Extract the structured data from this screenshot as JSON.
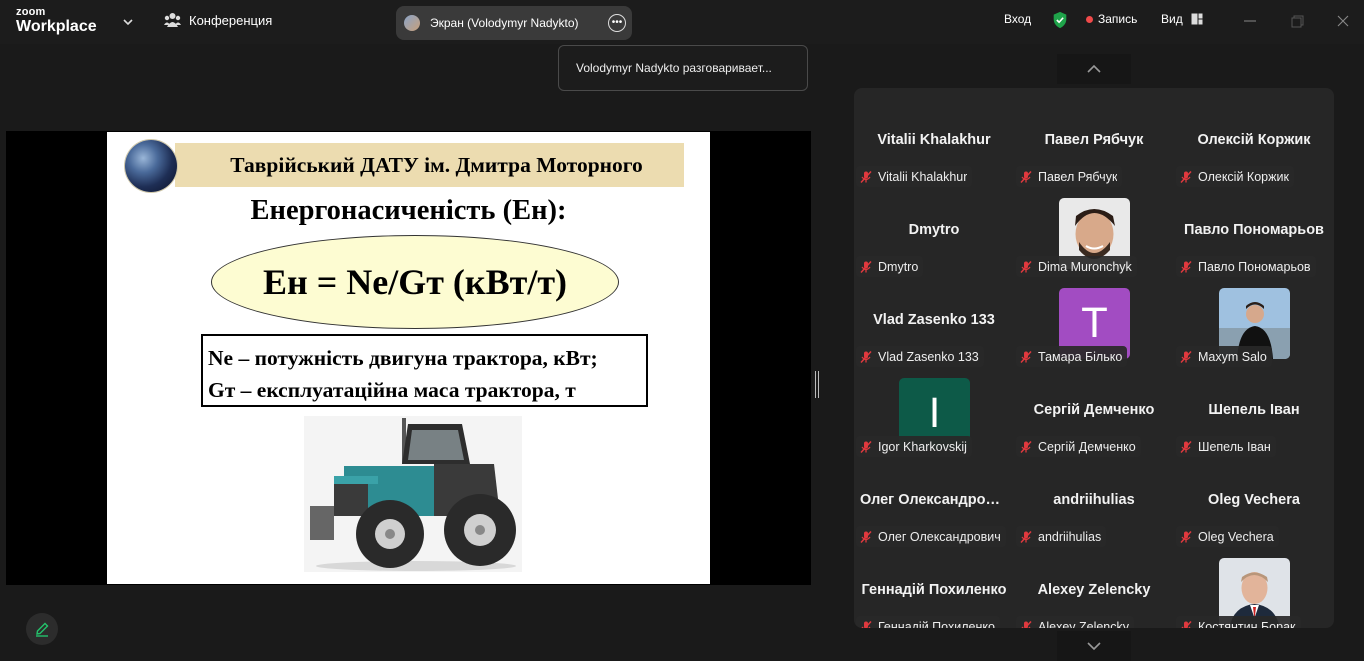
{
  "app": {
    "logo_line1": "zoom",
    "logo_line2": "Workplace"
  },
  "topbar": {
    "meeting_label": "Конференция",
    "share_label": "Экран (Volodymyr Nadykto)",
    "login_label": "Вход",
    "record_label": "Запись",
    "view_label": "Вид"
  },
  "tooltip": {
    "text": "Volodymyr Nadykto разговаривает..."
  },
  "slide": {
    "banner": "Таврійський ДАТУ ім. Дмитра Моторного",
    "title": "Енергонасиченість (Ен):",
    "formula": "Ен = Ne/Gт (кВт/т)",
    "def1": "Ne – потужність двигуна трактора, кВт;",
    "def2": "Gт – експлуатаційна маса трактора, т"
  },
  "participants": [
    {
      "big": "Vitalii Khalakhur",
      "label": "Vitalii Khalakhur"
    },
    {
      "big": "Павел Рябчук",
      "label": "Павел Рябчук"
    },
    {
      "big": "Олексій Коржик",
      "label": "Олексій Коржик"
    },
    {
      "big": "Dmytro",
      "label": "Dmytro"
    },
    {
      "big": "",
      "label": "Dima Muronchyk"
    },
    {
      "big": "Павло  Пономарьов",
      "label": "Павло Пономарьов"
    },
    {
      "big": "Vlad Zasenko 133",
      "label": "Vlad Zasenko 133"
    },
    {
      "big": "",
      "label": "Тамара Білько",
      "avatar_letter": "T"
    },
    {
      "big": "",
      "label": "Maxym Salo"
    },
    {
      "big": "",
      "label": "Igor Kharkovskij",
      "avatar_letter": "I"
    },
    {
      "big": "Сергій Демченко",
      "label": "Сергій Демченко"
    },
    {
      "big": "Шепель Іван",
      "label": "Шепель Іван"
    },
    {
      "big": "Олег  Олександрович",
      "label": "Олег Олександрович"
    },
    {
      "big": "andriihulias",
      "label": "andriihulias"
    },
    {
      "big": "Oleg Vechera",
      "label": "Oleg Vechera"
    },
    {
      "big": "Геннадій  Похиленко",
      "label": "Геннадій Похиленко"
    },
    {
      "big": "Alexey Zelencky",
      "label": "Alexey Zelencky"
    },
    {
      "big": "",
      "label": "Костянтин Борак"
    }
  ],
  "colors": {
    "muted_mic": "#e0393e",
    "shield": "#1fa34a",
    "record": "#f04a4a",
    "avatar_purple": "#a24cc2",
    "avatar_green": "#0d5a48",
    "pencil": "#23c26b"
  },
  "icons": [
    "chevron-down-icon",
    "conference-icon",
    "more-icon",
    "shield-icon",
    "record-dot-icon",
    "view-icon",
    "minimize-icon",
    "restore-icon",
    "close-icon",
    "muted-mic-icon",
    "pencil-icon",
    "chevron-up-icon"
  ]
}
